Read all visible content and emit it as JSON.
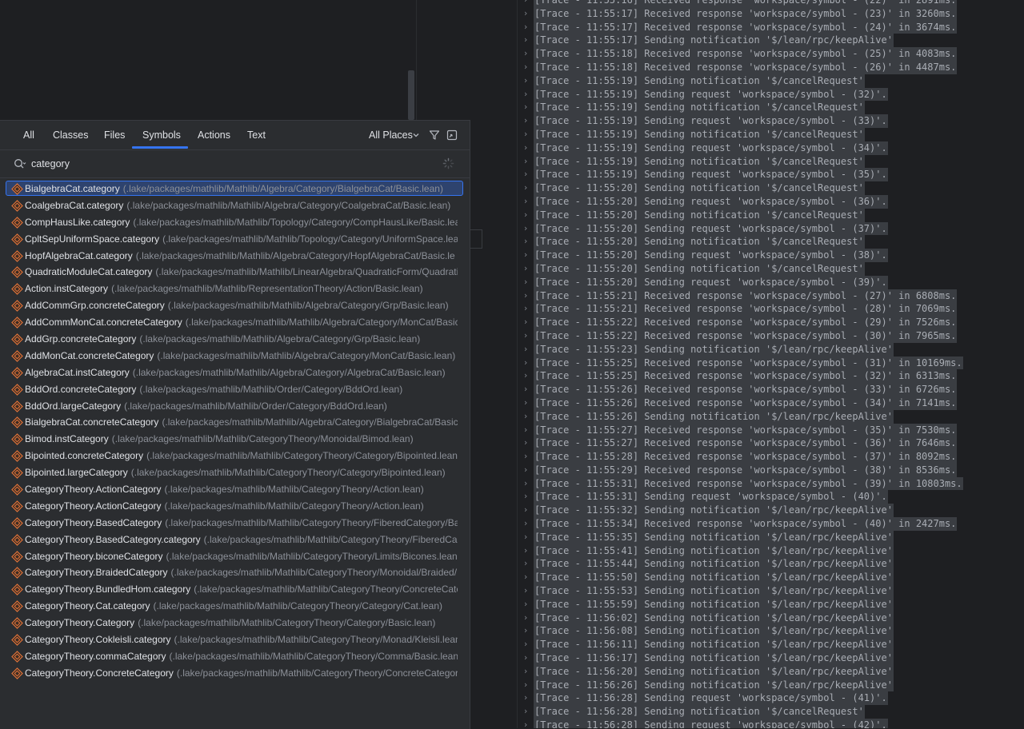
{
  "popup": {
    "tabs": [
      "All",
      "Classes",
      "Files",
      "Symbols",
      "Actions",
      "Text"
    ],
    "active_tab": "Symbols",
    "scope": "All Places",
    "search_value": "category",
    "accent_color": "#3574f0",
    "results": [
      {
        "name": "BialgebraCat.category",
        "path": "(.lake/packages/mathlib/Mathlib/Algebra/Category/BialgebraCat/Basic.lean)"
      },
      {
        "name": "CoalgebraCat.category",
        "path": "(.lake/packages/mathlib/Mathlib/Algebra/Category/CoalgebraCat/Basic.lean)"
      },
      {
        "name": "CompHausLike.category",
        "path": "(.lake/packages/mathlib/Mathlib/Topology/Category/CompHausLike/Basic.lea"
      },
      {
        "name": "CpltSepUniformSpace.category",
        "path": "(.lake/packages/mathlib/Mathlib/Topology/Category/UniformSpace.lean)"
      },
      {
        "name": "HopfAlgebraCat.category",
        "path": "(.lake/packages/mathlib/Mathlib/Algebra/Category/HopfAlgebraCat/Basic.le"
      },
      {
        "name": "QuadraticModuleCat.category",
        "path": "(.lake/packages/mathlib/Mathlib/LinearAlgebra/QuadraticForm/Quadrati"
      },
      {
        "name": "Action.instCategory",
        "path": "(.lake/packages/mathlib/Mathlib/RepresentationTheory/Action/Basic.lean)"
      },
      {
        "name": "AddCommGrp.concreteCategory",
        "path": "(.lake/packages/mathlib/Mathlib/Algebra/Category/Grp/Basic.lean)"
      },
      {
        "name": "AddCommMonCat.concreteCategory",
        "path": "(.lake/packages/mathlib/Mathlib/Algebra/Category/MonCat/Basic"
      },
      {
        "name": "AddGrp.concreteCategory",
        "path": "(.lake/packages/mathlib/Mathlib/Algebra/Category/Grp/Basic.lean)"
      },
      {
        "name": "AddMonCat.concreteCategory",
        "path": "(.lake/packages/mathlib/Mathlib/Algebra/Category/MonCat/Basic.lean)"
      },
      {
        "name": "AlgebraCat.instCategory",
        "path": "(.lake/packages/mathlib/Mathlib/Algebra/Category/AlgebraCat/Basic.lean)"
      },
      {
        "name": "BddOrd.concreteCategory",
        "path": "(.lake/packages/mathlib/Mathlib/Order/Category/BddOrd.lean)"
      },
      {
        "name": "BddOrd.largeCategory",
        "path": "(.lake/packages/mathlib/Mathlib/Order/Category/BddOrd.lean)"
      },
      {
        "name": "BialgebraCat.concreteCategory",
        "path": "(.lake/packages/mathlib/Mathlib/Algebra/Category/BialgebraCat/Basic"
      },
      {
        "name": "Bimod.instCategory",
        "path": "(.lake/packages/mathlib/Mathlib/CategoryTheory/Monoidal/Bimod.lean)"
      },
      {
        "name": "Bipointed.concreteCategory",
        "path": "(.lake/packages/mathlib/Mathlib/CategoryTheory/Category/Bipointed.lean"
      },
      {
        "name": "Bipointed.largeCategory",
        "path": "(.lake/packages/mathlib/Mathlib/CategoryTheory/Category/Bipointed.lean)"
      },
      {
        "name": "CategoryTheory.ActionCategory",
        "path": "(.lake/packages/mathlib/Mathlib/CategoryTheory/Action.lean)"
      },
      {
        "name": "CategoryTheory.ActionCategory",
        "path": "(.lake/packages/mathlib/Mathlib/CategoryTheory/Action.lean)"
      },
      {
        "name": "CategoryTheory.BasedCategory",
        "path": "(.lake/packages/mathlib/Mathlib/CategoryTheory/FiberedCategory/Ba"
      },
      {
        "name": "CategoryTheory.BasedCategory.category",
        "path": "(.lake/packages/mathlib/Mathlib/CategoryTheory/FiberedCa"
      },
      {
        "name": "CategoryTheory.biconeCategory",
        "path": "(.lake/packages/mathlib/Mathlib/CategoryTheory/Limits/Bicones.lean"
      },
      {
        "name": "CategoryTheory.BraidedCategory",
        "path": "(.lake/packages/mathlib/Mathlib/CategoryTheory/Monoidal/Braided/"
      },
      {
        "name": "CategoryTheory.BundledHom.category",
        "path": "(.lake/packages/mathlib/Mathlib/CategoryTheory/ConcreteCate"
      },
      {
        "name": "CategoryTheory.Cat.category",
        "path": "(.lake/packages/mathlib/Mathlib/CategoryTheory/Category/Cat.lean)"
      },
      {
        "name": "CategoryTheory.Category",
        "path": "(.lake/packages/mathlib/Mathlib/CategoryTheory/Category/Basic.lean)"
      },
      {
        "name": "CategoryTheory.Cokleisli.category",
        "path": "(.lake/packages/mathlib/Mathlib/CategoryTheory/Monad/Kleisli.lean"
      },
      {
        "name": "CategoryTheory.commaCategory",
        "path": "(.lake/packages/mathlib/Mathlib/CategoryTheory/Comma/Basic.lean"
      },
      {
        "name": "CategoryTheory.ConcreteCategory",
        "path": "(.lake/packages/mathlib/Mathlib/CategoryTheory/ConcreteCategor"
      }
    ]
  },
  "log": {
    "lines": [
      "[Trace - 11:55:16] Received response 'workspace/symbol - (22)' in 2891ms.",
      "[Trace - 11:55:17] Received response 'workspace/symbol - (23)' in 3260ms.",
      "[Trace - 11:55:17] Received response 'workspace/symbol - (24)' in 3674ms.",
      "[Trace - 11:55:17] Sending notification '$/lean/rpc/keepAlive'",
      "[Trace - 11:55:18] Received response 'workspace/symbol - (25)' in 4083ms.",
      "[Trace - 11:55:18] Received response 'workspace/symbol - (26)' in 4487ms.",
      "[Trace - 11:55:19] Sending notification '$/cancelRequest'",
      "[Trace - 11:55:19] Sending request 'workspace/symbol - (32)'.",
      "[Trace - 11:55:19] Sending notification '$/cancelRequest'",
      "[Trace - 11:55:19] Sending request 'workspace/symbol - (33)'.",
      "[Trace - 11:55:19] Sending notification '$/cancelRequest'",
      "[Trace - 11:55:19] Sending request 'workspace/symbol - (34)'.",
      "[Trace - 11:55:19] Sending notification '$/cancelRequest'",
      "[Trace - 11:55:19] Sending request 'workspace/symbol - (35)'.",
      "[Trace - 11:55:20] Sending notification '$/cancelRequest'",
      "[Trace - 11:55:20] Sending request 'workspace/symbol - (36)'.",
      "[Trace - 11:55:20] Sending notification '$/cancelRequest'",
      "[Trace - 11:55:20] Sending request 'workspace/symbol - (37)'.",
      "[Trace - 11:55:20] Sending notification '$/cancelRequest'",
      "[Trace - 11:55:20] Sending request 'workspace/symbol - (38)'.",
      "[Trace - 11:55:20] Sending notification '$/cancelRequest'",
      "[Trace - 11:55:20] Sending request 'workspace/symbol - (39)'.",
      "[Trace - 11:55:21] Received response 'workspace/symbol - (27)' in 6808ms.",
      "[Trace - 11:55:21] Received response 'workspace/symbol - (28)' in 7069ms.",
      "[Trace - 11:55:22] Received response 'workspace/symbol - (29)' in 7526ms.",
      "[Trace - 11:55:22] Received response 'workspace/symbol - (30)' in 7965ms.",
      "[Trace - 11:55:23] Sending notification '$/lean/rpc/keepAlive'",
      "[Trace - 11:55:25] Received response 'workspace/symbol - (31)' in 10169ms.",
      "[Trace - 11:55:25] Received response 'workspace/symbol - (32)' in 6313ms.",
      "[Trace - 11:55:26] Received response 'workspace/symbol - (33)' in 6726ms.",
      "[Trace - 11:55:26] Received response 'workspace/symbol - (34)' in 7141ms.",
      "[Trace - 11:55:26] Sending notification '$/lean/rpc/keepAlive'",
      "[Trace - 11:55:27] Received response 'workspace/symbol - (35)' in 7530ms.",
      "[Trace - 11:55:27] Received response 'workspace/symbol - (36)' in 7646ms.",
      "[Trace - 11:55:28] Received response 'workspace/symbol - (37)' in 8092ms.",
      "[Trace - 11:55:29] Received response 'workspace/symbol - (38)' in 8536ms.",
      "[Trace - 11:55:31] Received response 'workspace/symbol - (39)' in 10803ms.",
      "[Trace - 11:55:31] Sending request 'workspace/symbol - (40)'.",
      "[Trace - 11:55:32] Sending notification '$/lean/rpc/keepAlive'",
      "[Trace - 11:55:34] Received response 'workspace/symbol - (40)' in 2427ms.",
      "[Trace - 11:55:35] Sending notification '$/lean/rpc/keepAlive'",
      "[Trace - 11:55:41] Sending notification '$/lean/rpc/keepAlive'",
      "[Trace - 11:55:44] Sending notification '$/lean/rpc/keepAlive'",
      "[Trace - 11:55:50] Sending notification '$/lean/rpc/keepAlive'",
      "[Trace - 11:55:53] Sending notification '$/lean/rpc/keepAlive'",
      "[Trace - 11:55:59] Sending notification '$/lean/rpc/keepAlive'",
      "[Trace - 11:56:02] Sending notification '$/lean/rpc/keepAlive'",
      "[Trace - 11:56:08] Sending notification '$/lean/rpc/keepAlive'",
      "[Trace - 11:56:11] Sending notification '$/lean/rpc/keepAlive'",
      "[Trace - 11:56:17] Sending notification '$/lean/rpc/keepAlive'",
      "[Trace - 11:56:20] Sending notification '$/lean/rpc/keepAlive'",
      "[Trace - 11:56:26] Sending notification '$/lean/rpc/keepAlive'",
      "[Trace - 11:56:28] Sending request 'workspace/symbol - (41)'.",
      "[Trace - 11:56:28] Sending notification '$/cancelRequest'",
      "[Trace - 11:56:28] Sending request 'workspace/symbol - (42)'."
    ]
  }
}
